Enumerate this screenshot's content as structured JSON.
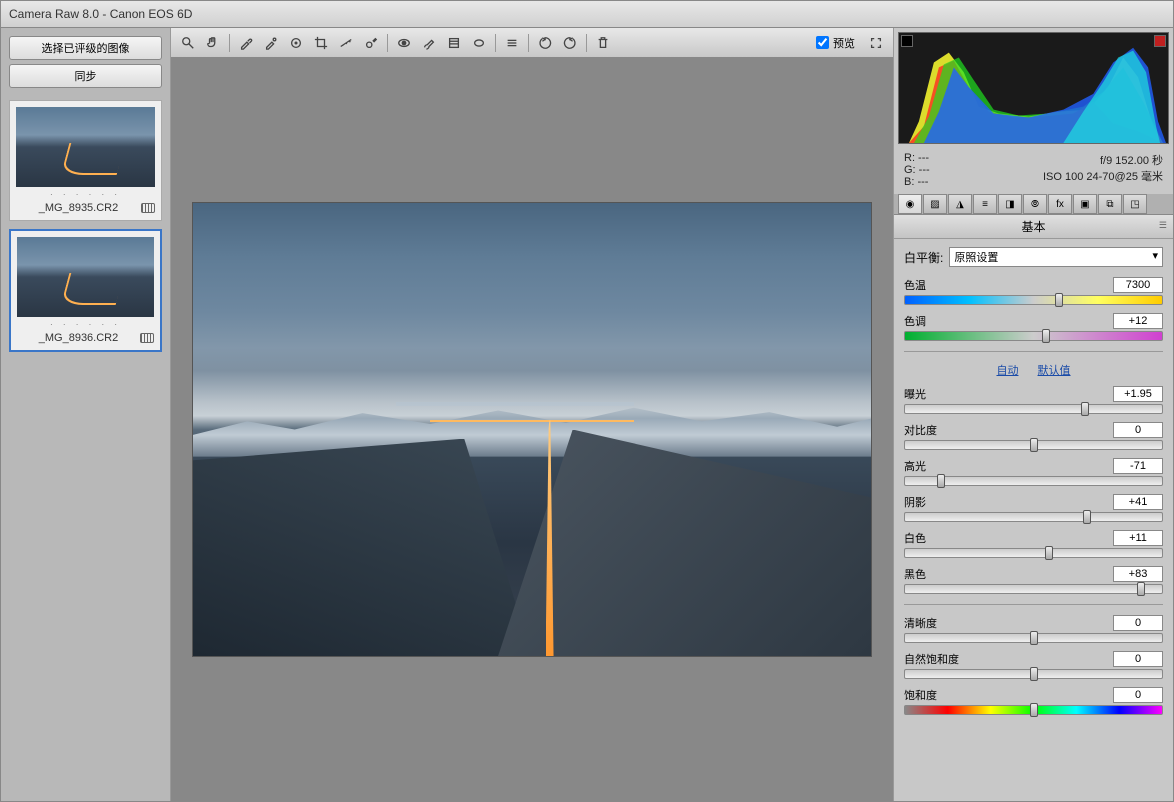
{
  "title": "Camera Raw 8.0  -  Canon EOS 6D",
  "left": {
    "select_rated": "选择已评级的图像",
    "sync": "同步",
    "thumbs": [
      {
        "name": "_MG_8935.CR2",
        "dots": "· · · · · ·"
      },
      {
        "name": "_MG_8936.CR2",
        "dots": "· · · · · ·"
      }
    ]
  },
  "toolbar": {
    "preview_label": "预览"
  },
  "meta": {
    "r": "R:  ---",
    "g": "G:  ---",
    "b": "B:  ---",
    "exp": "f/9   152.00 秒",
    "iso": "ISO 100   24-70@25 毫米"
  },
  "panel": {
    "header": "基本",
    "wb_label": "白平衡:",
    "wb_value": "原照设置",
    "auto": "自动",
    "default": "默认值",
    "sliders": {
      "temp": {
        "label": "色温",
        "value": "7300",
        "pos": 60,
        "track": "temp"
      },
      "tint": {
        "label": "色调",
        "value": "+12",
        "pos": 55,
        "track": "tint"
      },
      "expo": {
        "label": "曝光",
        "value": "+1.95",
        "pos": 70
      },
      "contr": {
        "label": "对比度",
        "value": "0",
        "pos": 50
      },
      "high": {
        "label": "高光",
        "value": "-71",
        "pos": 14
      },
      "shad": {
        "label": "阴影",
        "value": "+41",
        "pos": 71
      },
      "white": {
        "label": "白色",
        "value": "+11",
        "pos": 56
      },
      "black": {
        "label": "黑色",
        "value": "+83",
        "pos": 92
      },
      "clar": {
        "label": "清晰度",
        "value": "0",
        "pos": 50
      },
      "vib": {
        "label": "自然饱和度",
        "value": "0",
        "pos": 50
      },
      "sat": {
        "label": "饱和度",
        "value": "0",
        "pos": 50,
        "track": "sat"
      }
    }
  }
}
